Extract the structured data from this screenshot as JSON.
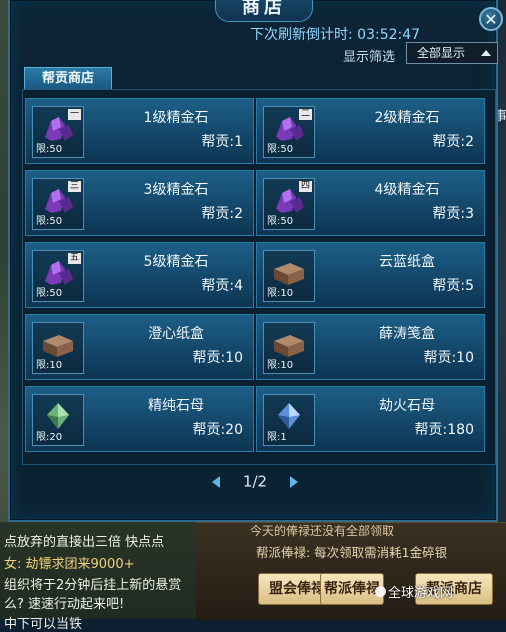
{
  "window": {
    "title": "商店",
    "close_label": "✕",
    "countdown_label": "下次刷新倒计时:",
    "countdown_value": "03:52:47",
    "filter_label": "显示筛选",
    "filter_selected": "全部显示",
    "shop_tab": "帮贡商店"
  },
  "items": [
    {
      "name": "1级精金石",
      "price": "帮贡:1",
      "limit": "限:50",
      "grade": "一",
      "icon": "purple-ore-icon"
    },
    {
      "name": "2级精金石",
      "price": "帮贡:2",
      "limit": "限:50",
      "grade": "二",
      "icon": "purple-ore-icon"
    },
    {
      "name": "3级精金石",
      "price": "帮贡:2",
      "limit": "限:50",
      "grade": "三",
      "icon": "purple-ore-icon"
    },
    {
      "name": "4级精金石",
      "price": "帮贡:3",
      "limit": "限:50",
      "grade": "四",
      "icon": "purple-ore-icon"
    },
    {
      "name": "5级精金石",
      "price": "帮贡:4",
      "limit": "限:50",
      "grade": "五",
      "icon": "purple-ore-icon"
    },
    {
      "name": "云蓝纸盒",
      "price": "帮贡:5",
      "limit": "限:10",
      "grade": "",
      "icon": "box-icon"
    },
    {
      "name": "澄心纸盒",
      "price": "帮贡:10",
      "limit": "限:10",
      "grade": "",
      "icon": "box-icon"
    },
    {
      "name": "薛涛笺盒",
      "price": "帮贡:10",
      "limit": "限:10",
      "grade": "",
      "icon": "box-icon"
    },
    {
      "name": "精纯石母",
      "price": "帮贡:20",
      "limit": "限:20",
      "grade": "",
      "icon": "green-stone-icon"
    },
    {
      "name": "劫火石母",
      "price": "帮贡:180",
      "limit": "限:1",
      "grade": "",
      "icon": "blue-stone-icon"
    }
  ],
  "pager": {
    "current": "1/2"
  },
  "chat": {
    "line1": "点放弃的直接出三倍  快点点",
    "line2": "女: 劫镖求团来9000+",
    "line3": " 组织将于2分钟后挂上新的悬赏",
    "line4": "么? 速速行动起来吧!",
    "line5": "中下可以当铁"
  },
  "salary": {
    "note1": "今天的俸禄还没有全部领取",
    "note2": "帮派俸禄: 每次领取需消耗1金碎银",
    "btn1": "盟会俸禄",
    "btn2": "帮派俸禄",
    "btn3": "帮派商店"
  },
  "watermark": "全球游戏网",
  "background": {
    "right_text": "事"
  },
  "colors": {
    "accent": "#2a7aa7",
    "countdown": "#8fd7ff"
  }
}
